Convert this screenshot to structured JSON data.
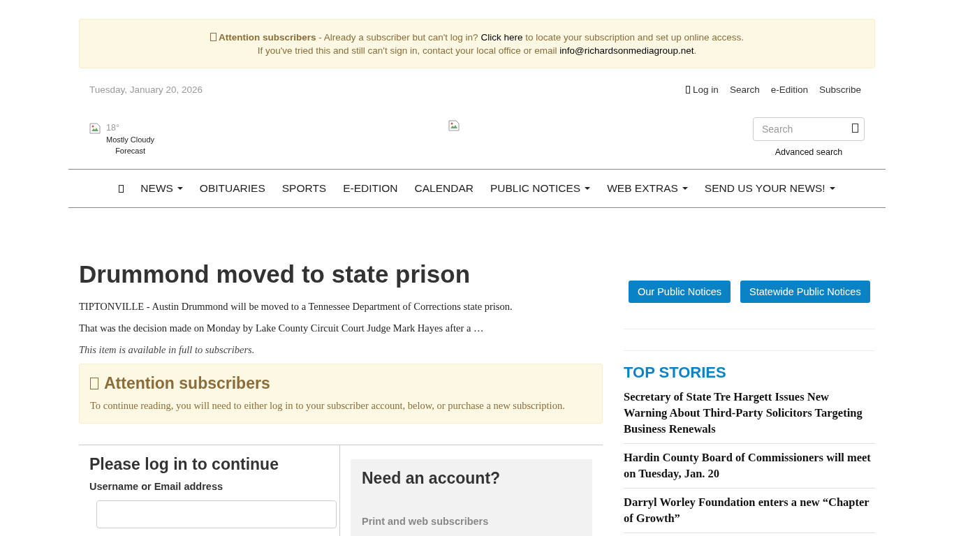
{
  "alert": {
    "title": "Attention subscribers",
    "text1": " - Already a subscriber but can't log in? ",
    "link1": "Click here",
    "text2": " to locate your subscription and set up online access.",
    "text3": "If you've tried this and still can't sign in, contact your local office or email ",
    "link2": "info@richardsonmediagroup.net",
    "text4": "."
  },
  "topbar": {
    "date": "Tuesday, January 20, 2026",
    "links": [
      {
        "kind": "login",
        "label": "Log in"
      },
      {
        "kind": "plain",
        "label": "Search"
      },
      {
        "kind": "plain",
        "label": "e-Edition"
      },
      {
        "kind": "plain",
        "label": "Subscribe"
      }
    ]
  },
  "weather": {
    "temperature": "18°",
    "condition": "Mostly Cloudy",
    "link": "Forecast"
  },
  "search": {
    "placeholder": "Search",
    "advanced": "Advanced search"
  },
  "nav": [
    {
      "kind": "home"
    },
    {
      "kind": "menu",
      "label": "NEWS"
    },
    {
      "kind": "link",
      "label": "OBITUARIES"
    },
    {
      "kind": "link",
      "label": "SPORTS"
    },
    {
      "kind": "link",
      "label": "E-EDITION"
    },
    {
      "kind": "link",
      "label": "CALENDAR"
    },
    {
      "kind": "menu",
      "label": "PUBLIC NOTICES"
    },
    {
      "kind": "menu",
      "label": "WEB EXTRAS"
    },
    {
      "kind": "menu",
      "label": "SEND US YOUR NEWS!"
    }
  ],
  "article": {
    "title": "Drummond moved to state prison",
    "paragraphs": [
      "TIPTONVILLE - Austin Drummond will be moved to a Tennessee Department of Corrections state prison.",
      "That was the decision made on Monday by Lake County Circuit Court Judge Mark Hayes after a …"
    ],
    "note": "This item is available in full to subscribers."
  },
  "paywall": {
    "title": "Attention subscribers",
    "text": "To continue reading, you will need to either log in to your subscriber account, below, or purchase a new subscription."
  },
  "login": {
    "title": "Please log in to continue",
    "username_label": "Username or Email address"
  },
  "account": {
    "title": "Need an account?",
    "subtitle": "Print and web subscribers"
  },
  "sidebar": {
    "buttons": [
      "Our Public Notices",
      "Statewide Public Notices"
    ],
    "top_stories_title": "TOP STORIES",
    "stories": [
      "Secretary of State Tre Hargett Issues New Warning About Third-Party Solicitors Targeting Business Renewals",
      "Hardin County Board of Commissioners will meet on Tuesday, Jan. 20",
      "Darryl Worley Foundation enters a new “Chapter of Growth”"
    ]
  }
}
